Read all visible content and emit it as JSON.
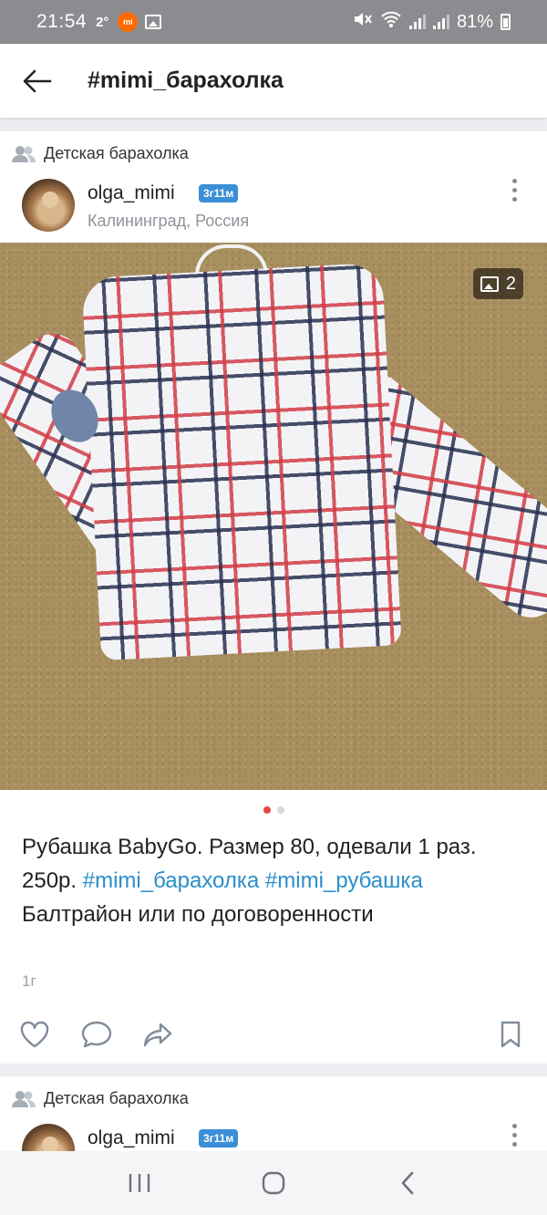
{
  "status_bar": {
    "time": "21:54",
    "temperature": "2°",
    "notification_icon": "mi",
    "battery": "81%"
  },
  "header": {
    "title": "#mimi_барахолка"
  },
  "posts": [
    {
      "group_name": "Детская барахолка",
      "author": "olga_mimi",
      "badge": "3г11м",
      "location": "Калининград, Россия",
      "photo_count": "2",
      "text_plain_1": "Рубашка BabyGo. Размер 80, одевали 1 раз. 250р. ",
      "tag_1": "#mimi_барахолка",
      "text_space": " ",
      "tag_2": "#mimi_рубашка",
      "text_plain_2": " Балтрайон или по договоренности",
      "age": "1г"
    },
    {
      "group_name": "Детская барахолка",
      "author": "olga_mimi",
      "badge": "3г11м"
    }
  ],
  "colors": {
    "accent": "#2a8fc9",
    "badge": "#3a8fd7",
    "active_dot": "#e64646"
  }
}
